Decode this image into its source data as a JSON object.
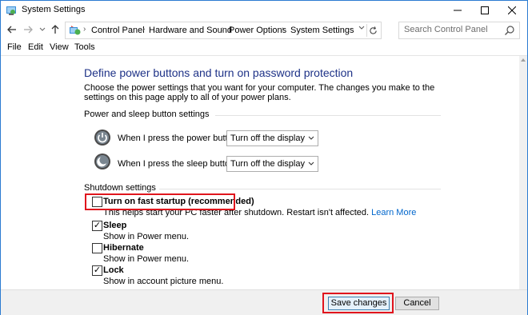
{
  "window": {
    "title": "System Settings"
  },
  "address": {
    "crumbs": [
      "Control Panel",
      "Hardware and Sound",
      "Power Options",
      "System Settings"
    ],
    "search_placeholder": "Search Control Panel"
  },
  "menu": {
    "items": [
      "File",
      "Edit",
      "View",
      "Tools"
    ]
  },
  "page": {
    "title": "Define power buttons and turn on password protection",
    "description": "Choose the power settings that you want for your computer. The changes you make to the settings on this page apply to all of your power plans."
  },
  "power_section": {
    "heading": "Power and sleep button settings",
    "power_label": "When I press the power button:",
    "power_value": "Turn off the display",
    "sleep_label": "When I press the sleep button:",
    "sleep_value": "Turn off the display"
  },
  "shutdown_section": {
    "heading": "Shutdown settings",
    "options": [
      {
        "label": "Turn on fast startup (recommended)",
        "desc": "This helps start your PC faster after shutdown. Restart isn't affected.",
        "link": "Learn More",
        "checked": false
      },
      {
        "label": "Sleep",
        "desc": "Show in Power menu.",
        "checked": true
      },
      {
        "label": "Hibernate",
        "desc": "Show in Power menu.",
        "checked": false
      },
      {
        "label": "Lock",
        "desc": "Show in account picture menu.",
        "checked": true
      }
    ]
  },
  "footer": {
    "save_label": "Save changes",
    "cancel_label": "Cancel"
  },
  "colors": {
    "title_blue": "#1e3287",
    "link_blue": "#0066cc",
    "highlight_red": "#e0151d",
    "window_border": "#2b7bd1"
  },
  "icons": [
    "app-icon",
    "back-icon",
    "forward-icon",
    "up-icon",
    "refresh-icon",
    "search-icon",
    "power-button-icon",
    "sleep-button-icon"
  ]
}
